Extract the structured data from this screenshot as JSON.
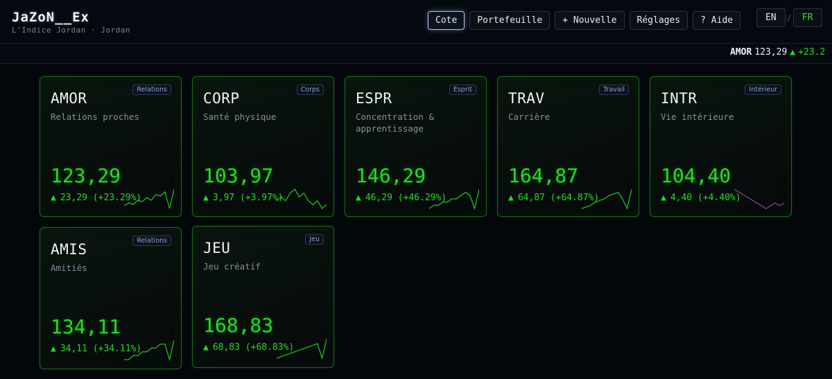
{
  "brand": {
    "title": "JaZoN__Ex",
    "subtitle": "L'Indice Jordan · Jordan"
  },
  "nav": [
    {
      "label": "Cote",
      "active": true
    },
    {
      "label": "Portefeuille",
      "active": false
    },
    {
      "label": "+ Nouvelle",
      "active": false
    },
    {
      "label": "Réglages",
      "active": false
    },
    {
      "label": "? Aide",
      "active": false
    }
  ],
  "lang": {
    "en": "EN",
    "sep": "/",
    "fr": "FR",
    "active": "FR"
  },
  "ticker": {
    "symbol": "AMOR",
    "value": "123,29",
    "arrow": "▲",
    "change": "+23.2"
  },
  "colors": {
    "up": "#22dd22",
    "down": "#b04aa8",
    "border": "#1c6a1c"
  },
  "cards": [
    {
      "symbol": "AMOR",
      "tag": "Relations",
      "desc": "Relations proches",
      "value": "123,29",
      "arrow": "▲",
      "change": "23,29 (+23.29%)",
      "trend": "up",
      "spark": [
        3,
        4,
        3.5,
        5,
        4.5,
        6,
        5,
        7,
        6.5,
        8,
        2,
        9
      ]
    },
    {
      "symbol": "CORP",
      "tag": "Corps",
      "desc": "Santé physique",
      "value": "103,97",
      "arrow": "▲",
      "change": "3,97 (+3.97%)",
      "trend": "up",
      "spark": [
        5,
        6,
        5,
        7,
        8,
        6,
        7,
        5,
        4,
        5,
        3,
        4
      ]
    },
    {
      "symbol": "ESPR",
      "tag": "Esprit",
      "desc": "Concentration & apprentissage",
      "value": "146,29",
      "arrow": "▲",
      "change": "46,29 (+46.29%)",
      "trend": "up",
      "spark": [
        3,
        4,
        4,
        5,
        5,
        6,
        6,
        7,
        8,
        7,
        3,
        9
      ]
    },
    {
      "symbol": "TRAV",
      "tag": "Travail",
      "desc": "Carrière",
      "value": "164,87",
      "arrow": "▲",
      "change": "64,87 (+64.87%)",
      "trend": "up",
      "spark": [
        3,
        3.5,
        4,
        5,
        5.5,
        6,
        7,
        7.5,
        8,
        6,
        3,
        9
      ]
    },
    {
      "symbol": "INTR",
      "tag": "Intérieur",
      "desc": "Vie intérieure",
      "value": "104,40",
      "arrow": "▲",
      "change": "4,40 (+4.40%)",
      "trend": "down",
      "spark": [
        8,
        7,
        6,
        5,
        4,
        3,
        2,
        1,
        2,
        3,
        2,
        3
      ]
    },
    {
      "symbol": "AMIS",
      "tag": "Relations",
      "desc": "Amitiés",
      "value": "134,11",
      "arrow": "▲",
      "change": "34,11 (+34.11%)",
      "trend": "up",
      "spark": [
        3,
        3,
        4,
        4,
        5,
        5,
        6,
        6,
        7,
        7,
        3,
        8
      ]
    },
    {
      "symbol": "JEU",
      "tag": "Jeu",
      "desc": "Jeu créatif",
      "value": "168,83",
      "arrow": "▲",
      "change": "68,83 (+68.83%)",
      "trend": "up",
      "spark": [
        3,
        3.5,
        4,
        4.5,
        5,
        5.5,
        6,
        6.5,
        7,
        7.5,
        3,
        9
      ]
    }
  ]
}
